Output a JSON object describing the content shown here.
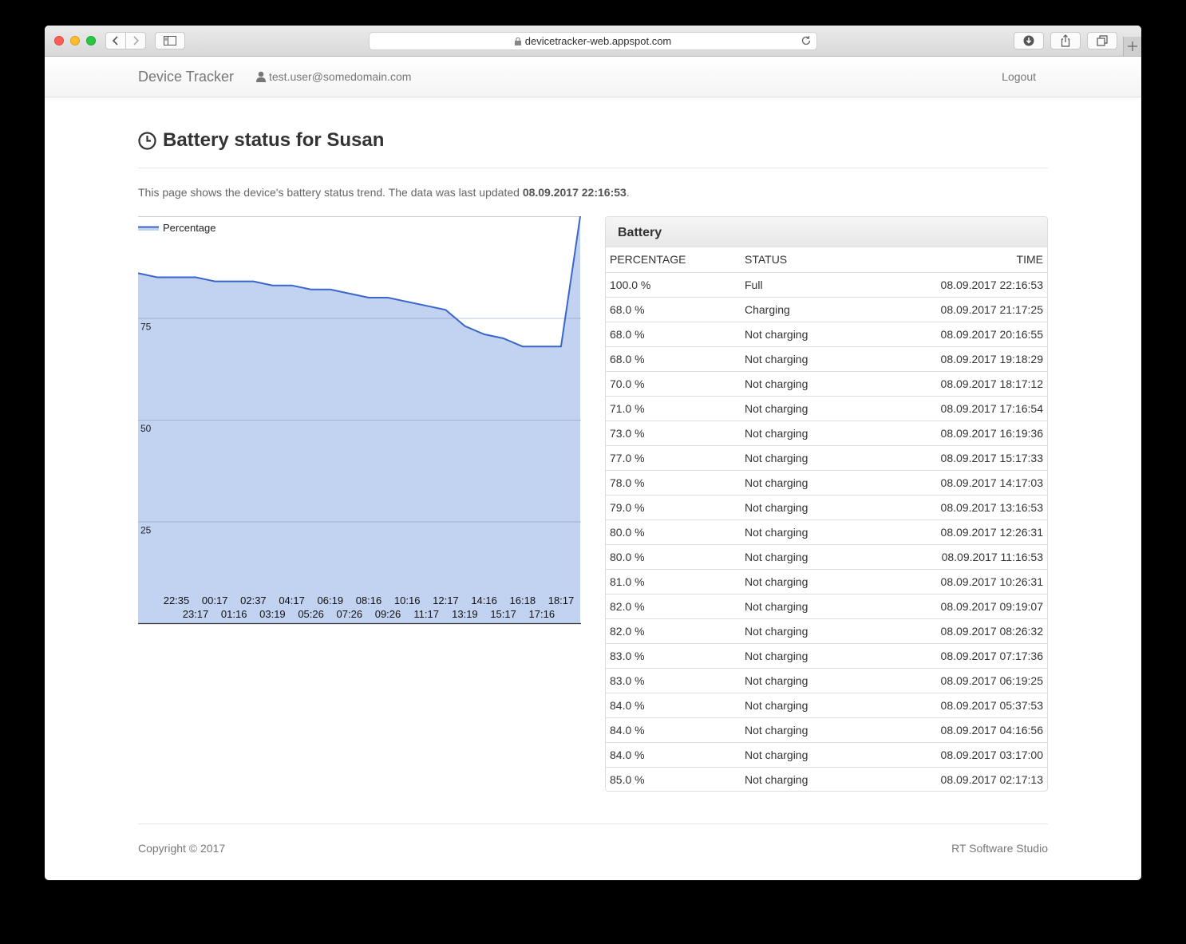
{
  "browser": {
    "url": "devicetracker-web.appspot.com"
  },
  "navbar": {
    "brand": "Device Tracker",
    "user_email": "test.user@somedomain.com",
    "logout_label": "Logout"
  },
  "page": {
    "title": "Battery status for Susan",
    "intro_text": "This page shows the device's battery status trend. The data was last updated ",
    "last_updated": "08.09.2017 22:16:53",
    "intro_suffix": "."
  },
  "chart_data": {
    "type": "area",
    "legend": "Percentage",
    "legend_position": "top-left",
    "ylim": [
      0,
      100
    ],
    "y_ticks": [
      25,
      50,
      75
    ],
    "grid": true,
    "color": "#3b66c9",
    "fill_color": "#c2d3f1",
    "x_labels_top": [
      "22:35",
      "00:17",
      "02:37",
      "04:17",
      "06:19",
      "08:16",
      "10:16",
      "12:17",
      "14:16",
      "16:18",
      "18:17"
    ],
    "x_labels_bottom": [
      "23:17",
      "01:16",
      "03:19",
      "05:26",
      "07:26",
      "09:26",
      "11:17",
      "13:19",
      "15:17",
      "17:16"
    ],
    "values": [
      86,
      85,
      85,
      85,
      84,
      84,
      84,
      83,
      83,
      82,
      82,
      81,
      80,
      80,
      79,
      78,
      77,
      73,
      71,
      70,
      68,
      68,
      68,
      100
    ]
  },
  "battery": {
    "heading": "Battery",
    "columns": [
      "PERCENTAGE",
      "STATUS",
      "TIME"
    ],
    "rows": [
      [
        "100.0 %",
        "Full",
        "08.09.2017 22:16:53"
      ],
      [
        "68.0 %",
        "Charging",
        "08.09.2017 21:17:25"
      ],
      [
        "68.0 %",
        "Not charging",
        "08.09.2017 20:16:55"
      ],
      [
        "68.0 %",
        "Not charging",
        "08.09.2017 19:18:29"
      ],
      [
        "70.0 %",
        "Not charging",
        "08.09.2017 18:17:12"
      ],
      [
        "71.0 %",
        "Not charging",
        "08.09.2017 17:16:54"
      ],
      [
        "73.0 %",
        "Not charging",
        "08.09.2017 16:19:36"
      ],
      [
        "77.0 %",
        "Not charging",
        "08.09.2017 15:17:33"
      ],
      [
        "78.0 %",
        "Not charging",
        "08.09.2017 14:17:03"
      ],
      [
        "79.0 %",
        "Not charging",
        "08.09.2017 13:16:53"
      ],
      [
        "80.0 %",
        "Not charging",
        "08.09.2017 12:26:31"
      ],
      [
        "80.0 %",
        "Not charging",
        "08.09.2017 11:16:53"
      ],
      [
        "81.0 %",
        "Not charging",
        "08.09.2017 10:26:31"
      ],
      [
        "82.0 %",
        "Not charging",
        "08.09.2017 09:19:07"
      ],
      [
        "82.0 %",
        "Not charging",
        "08.09.2017 08:26:32"
      ],
      [
        "83.0 %",
        "Not charging",
        "08.09.2017 07:17:36"
      ],
      [
        "83.0 %",
        "Not charging",
        "08.09.2017 06:19:25"
      ],
      [
        "84.0 %",
        "Not charging",
        "08.09.2017 05:37:53"
      ],
      [
        "84.0 %",
        "Not charging",
        "08.09.2017 04:16:56"
      ],
      [
        "84.0 %",
        "Not charging",
        "08.09.2017 03:17:00"
      ],
      [
        "85.0 %",
        "Not charging",
        "08.09.2017 02:17:13"
      ]
    ]
  },
  "footer": {
    "copyright": "Copyright © 2017",
    "company": "RT Software Studio"
  }
}
